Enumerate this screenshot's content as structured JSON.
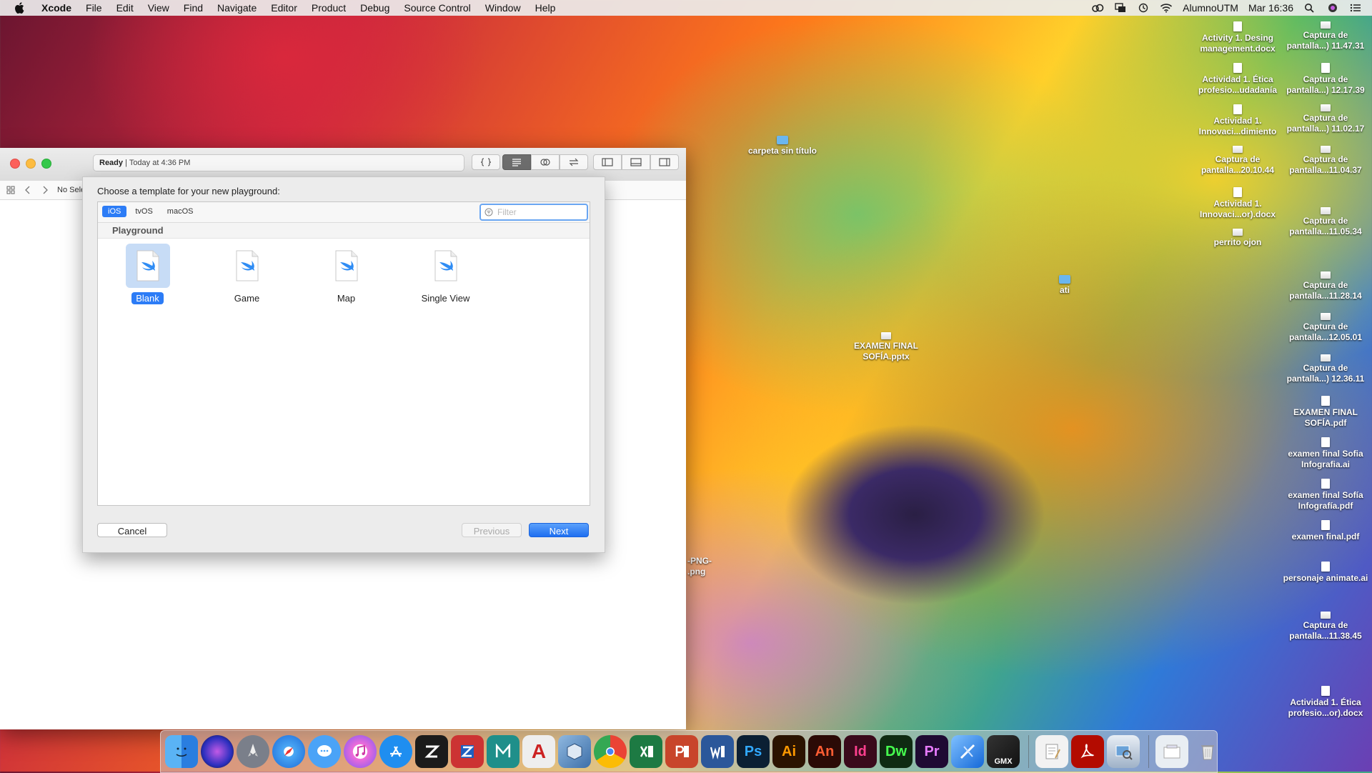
{
  "menubar": {
    "app": "Xcode",
    "items": [
      "File",
      "Edit",
      "View",
      "Find",
      "Navigate",
      "Editor",
      "Product",
      "Debug",
      "Source Control",
      "Window",
      "Help"
    ],
    "user": "AlumnoUTM",
    "clock": "Mar 16:36",
    "status_icons": [
      "creative-cloud-icon",
      "screen-mirror-icon",
      "time-machine-icon",
      "wifi-icon",
      "spotlight-icon",
      "siri-icon",
      "notification-center-icon"
    ]
  },
  "desktop": {
    "icons": [
      {
        "label": "Activity 1. Desing management.docx"
      },
      {
        "label": "Captura de pantalla...) 11.47.31"
      },
      {
        "label": "Actividad 1. Ética profesio...udadanía"
      },
      {
        "label": "Captura de pantalla...) 12.17.39"
      },
      {
        "label": "Actividad 1. Innovaci...dimiento"
      },
      {
        "label": "Captura de pantalla...) 11.02.17"
      },
      {
        "label": "Captura de pantalla...20.10.44"
      },
      {
        "label": "Captura de pantalla...11.04.37"
      },
      {
        "label": "Actividad 1. Innovaci...or).docx"
      },
      {
        "label": "Captura de pantalla...11.05.34"
      },
      {
        "label": "perrito ojon"
      },
      {
        "label": "Captura de pantalla...11.28.14"
      },
      {
        "label": "Captura de pantalla...12.05.01"
      },
      {
        "label": "Captura de pantalla...) 12.36.11"
      },
      {
        "label": "EXAMEN FINAL SOFÍA.pdf"
      },
      {
        "label": "examen final Sofia Infografia.ai"
      },
      {
        "label": "examen final Sofía Infografía.pdf"
      },
      {
        "label": "examen final.pdf"
      },
      {
        "label": "personaje animate.ai"
      },
      {
        "label": "Captura de pantalla...11.38.45"
      },
      {
        "label": "Actividad 1. Ética profesio...or).docx"
      },
      {
        "label": "carpeta sin título"
      },
      {
        "label": "ati"
      },
      {
        "label": "EXAMEN FINAL SOFÍA.pptx"
      },
      {
        "label": "-PNG-\n.png"
      }
    ]
  },
  "xcode_window": {
    "activity_status": "Ready",
    "activity_time": "Today at 4:36 PM",
    "nav_label": "No Sele"
  },
  "sheet": {
    "prompt": "Choose a template for your new playground:",
    "platforms": [
      "iOS",
      "tvOS",
      "macOS"
    ],
    "selected_platform": "iOS",
    "filter_placeholder": "Filter",
    "filter_value": "",
    "section": "Playground",
    "templates": [
      {
        "label": "Blank",
        "selected": true
      },
      {
        "label": "Game",
        "selected": false
      },
      {
        "label": "Map",
        "selected": false
      },
      {
        "label": "Single View",
        "selected": false
      }
    ],
    "cancel": "Cancel",
    "previous": "Previous",
    "next": "Next"
  },
  "dock": {
    "apps": [
      {
        "icon": "finder-icon"
      },
      {
        "icon": "siri-icon"
      },
      {
        "icon": "launchpad-icon"
      },
      {
        "icon": "safari-icon"
      },
      {
        "icon": "messages-icon"
      },
      {
        "icon": "itunes-icon"
      },
      {
        "icon": "app-store-icon"
      },
      {
        "icon": "zbrush-icon"
      },
      {
        "icon": "filezilla-icon"
      },
      {
        "icon": "maya-icon",
        "text": "MAYA"
      },
      {
        "icon": "autocad-icon",
        "text": "A"
      },
      {
        "icon": "virtualbox-icon"
      },
      {
        "icon": "chrome-icon"
      },
      {
        "icon": "excel-icon"
      },
      {
        "icon": "powerpoint-icon"
      },
      {
        "icon": "word-icon"
      },
      {
        "icon": "photoshop-icon",
        "text": "Ps"
      },
      {
        "icon": "illustrator-icon",
        "text": "Ai"
      },
      {
        "icon": "animate-icon",
        "text": "An"
      },
      {
        "icon": "indesign-icon",
        "text": "Id"
      },
      {
        "icon": "dreamweaver-icon",
        "text": "Dw"
      },
      {
        "icon": "premiere-icon",
        "text": "Pr"
      },
      {
        "icon": "xcode-icon"
      },
      {
        "icon": "gmx-icon",
        "text": "GMX"
      },
      {
        "icon": "textedit-icon"
      },
      {
        "icon": "acrobat-icon"
      },
      {
        "icon": "preview-icon"
      },
      {
        "icon": "downloads-stack-icon"
      },
      {
        "icon": "trash-icon"
      }
    ]
  },
  "colors": {
    "accent": "#2c7cf6",
    "selection_bg": "#c7dcf6"
  }
}
